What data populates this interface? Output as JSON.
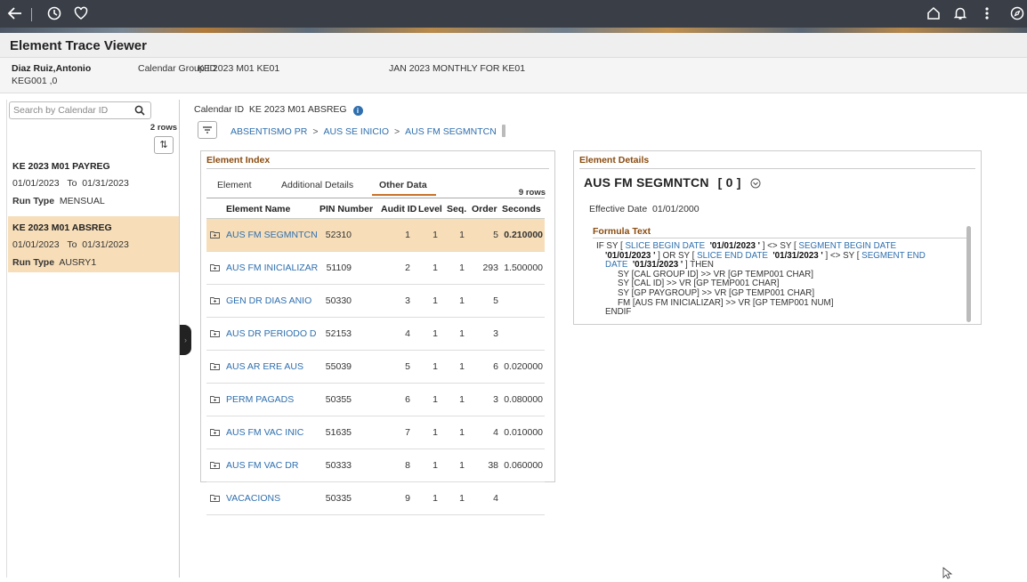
{
  "colors": {
    "accent_link": "#2f6fae",
    "section_title": "#8a4b0f",
    "selected_row": "#f7deb9",
    "tab_underline": "#c9722b"
  },
  "topbar": {
    "icons": [
      "back-arrow-icon",
      "history-clock-icon",
      "favorites-heart-icon",
      "home-icon",
      "notification-bell-icon",
      "more-options-icon",
      "navigator-compass-icon"
    ]
  },
  "title": "Element Trace Viewer",
  "header": {
    "employee_name": "Diaz Ruiz,Antonio",
    "employee_id": "KEG001 ,0",
    "calendar_group_label": "Calendar Group ID",
    "calendar_group_value": "KE 2023 M01 KE01",
    "calendar_desc": "JAN 2023 MONTHLY FOR KE01"
  },
  "left": {
    "search_placeholder": "Search by Calendar ID",
    "row_count": "2 rows",
    "items": [
      {
        "calendar_id": "KE 2023 M01 PAYREG",
        "from": "01/01/2023",
        "to_label": "To",
        "to": "01/31/2023",
        "run_type_label": "Run Type",
        "run_type": "MENSUAL"
      },
      {
        "calendar_id": "KE 2023 M01 ABSREG",
        "from": "01/01/2023",
        "to_label": "To",
        "to": "01/31/2023",
        "run_type_label": "Run Type",
        "run_type": "AUSRY1"
      }
    ]
  },
  "center": {
    "calendar_id_label": "Calendar ID",
    "calendar_id_value": "KE 2023 M01 ABSREG",
    "breadcrumb": [
      "ABSENTISMO PR",
      "AUS SE INICIO",
      "AUS FM SEGMNTCN"
    ],
    "breadcrumb_sep": ">"
  },
  "index": {
    "title": "Element Index",
    "tabs": [
      "Element",
      "Additional Details",
      "Other Data"
    ],
    "active_tab": "Other Data",
    "row_count": "9 rows",
    "columns": [
      "Element Name",
      "PIN Number",
      "Audit ID",
      "Level",
      "Seq.",
      "Order",
      "Seconds"
    ],
    "rows": [
      {
        "name": "AUS FM SEGMNTCN",
        "pin": "52310",
        "audit": "1",
        "level": "1",
        "seq": "1",
        "order": "5",
        "seconds": "0.210000"
      },
      {
        "name": "AUS FM INICIALIZAR",
        "pin": "51109",
        "audit": "2",
        "level": "1",
        "seq": "1",
        "order": "293",
        "seconds": "1.500000"
      },
      {
        "name": "GEN DR DIAS ANIO",
        "pin": "50330",
        "audit": "3",
        "level": "1",
        "seq": "1",
        "order": "5",
        "seconds": ""
      },
      {
        "name": "AUS DR PERIODO D",
        "pin": "52153",
        "audit": "4",
        "level": "1",
        "seq": "1",
        "order": "3",
        "seconds": ""
      },
      {
        "name": "AUS AR ERE AUS",
        "pin": "55039",
        "audit": "5",
        "level": "1",
        "seq": "1",
        "order": "6",
        "seconds": "0.020000"
      },
      {
        "name": "PERM PAGADS",
        "pin": "50355",
        "audit": "6",
        "level": "1",
        "seq": "1",
        "order": "3",
        "seconds": "0.080000"
      },
      {
        "name": "AUS FM VAC INIC",
        "pin": "51635",
        "audit": "7",
        "level": "1",
        "seq": "1",
        "order": "4",
        "seconds": "0.010000"
      },
      {
        "name": "AUS FM VAC DR",
        "pin": "50333",
        "audit": "8",
        "level": "1",
        "seq": "1",
        "order": "38",
        "seconds": "0.060000"
      },
      {
        "name": "VACACIONS",
        "pin": "50335",
        "audit": "9",
        "level": "1",
        "seq": "1",
        "order": "4",
        "seconds": ""
      }
    ]
  },
  "details": {
    "title": "Element Details",
    "element_name": "AUS FM SEGMNTCN",
    "element_index": "[ 0 ]",
    "effective_date_label": "Effective Date",
    "effective_date": "01/01/2000",
    "formula_title": "Formula Text",
    "formula": {
      "l1a": "IF SY [ ",
      "l1b": "SLICE BEGIN DATE",
      "l1c": "  '01/01/2023 '",
      "l1d": " ] <> SY [ ",
      "l1e": "SEGMENT BEGIN DATE",
      "l2a": "'01/01/2023 '",
      "l2b": " ] OR SY [ ",
      "l2c": "SLICE END DATE",
      "l2d": "  '01/31/2023 '",
      "l2e": " ] <> SY [ ",
      "l2f": "SEGMENT END",
      "l3a": "DATE",
      "l3b": "  '01/31/2023 '",
      "l3c": " ] THEN",
      "l4": "SY [CAL GROUP ID] >> VR [GP TEMP001 CHAR]",
      "l5": "SY [CAL ID] >> VR [GP TEMP001 CHAR]",
      "l6": "SY [GP PAYGROUP] >> VR [GP TEMP001 CHAR]",
      "l7": "FM [AUS FM INICIALIZAR] >> VR [GP TEMP001 NUM]",
      "l8": "ENDIF"
    }
  }
}
